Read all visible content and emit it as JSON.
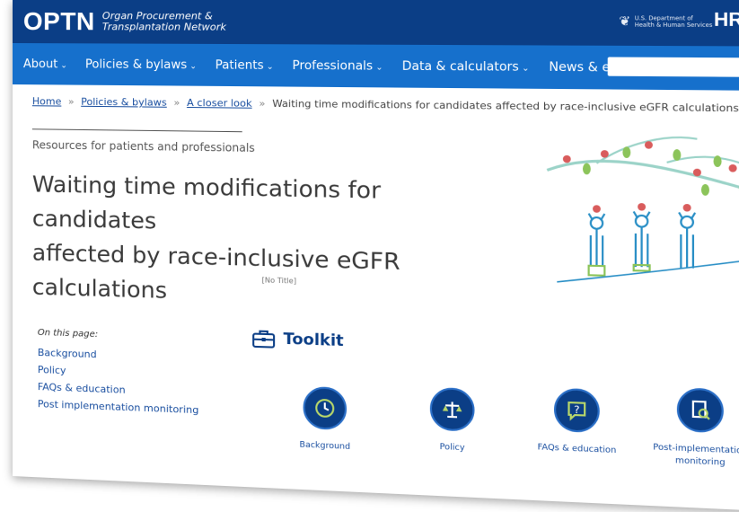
{
  "brand": {
    "logo": "OPTN",
    "logo_sub_line1": "Organ Procurement &",
    "logo_sub_line2": "Transplantation Network",
    "hhs_line1": "U.S. Department of",
    "hhs_line2": "Health & Human Services",
    "hrsa": "HRSA"
  },
  "nav": {
    "items": [
      {
        "label": "About"
      },
      {
        "label": "Policies & bylaws"
      },
      {
        "label": "Patients"
      },
      {
        "label": "Professionals"
      },
      {
        "label": "Data & calculators"
      },
      {
        "label": "News & events"
      }
    ],
    "chevron": "⌄",
    "search_placeholder": ""
  },
  "breadcrumb": {
    "home": "Home",
    "policies": "Policies & bylaws",
    "closer": "A closer look",
    "sep": "»",
    "current": "Waiting time modifications for candidates affected by race-inclusive eGFR calculations"
  },
  "page": {
    "eyebrow": "Resources for patients and professionals",
    "title_line1": "Waiting time modifications for candidates",
    "title_line2": "affected by race-inclusive eGFR calculations",
    "no_title": "[No Title]"
  },
  "on_this_page": {
    "label": "On this page:",
    "links": [
      "Background",
      "Policy",
      "FAQs & education",
      "Post implementation monitoring"
    ]
  },
  "toolkit": {
    "title": "Toolkit",
    "items": [
      {
        "label": "Background",
        "icon": "clock-icon"
      },
      {
        "label": "Policy",
        "icon": "scales-icon"
      },
      {
        "label": "FAQs & education",
        "icon": "question-bubble-icon"
      },
      {
        "label_line1": "Post-implementation",
        "label_line2": "monitoring",
        "icon": "document-search-icon"
      }
    ]
  },
  "colors": {
    "brand_navy": "#0b3e86",
    "nav_blue": "#1670cc",
    "link_blue": "#1a4fa0"
  }
}
